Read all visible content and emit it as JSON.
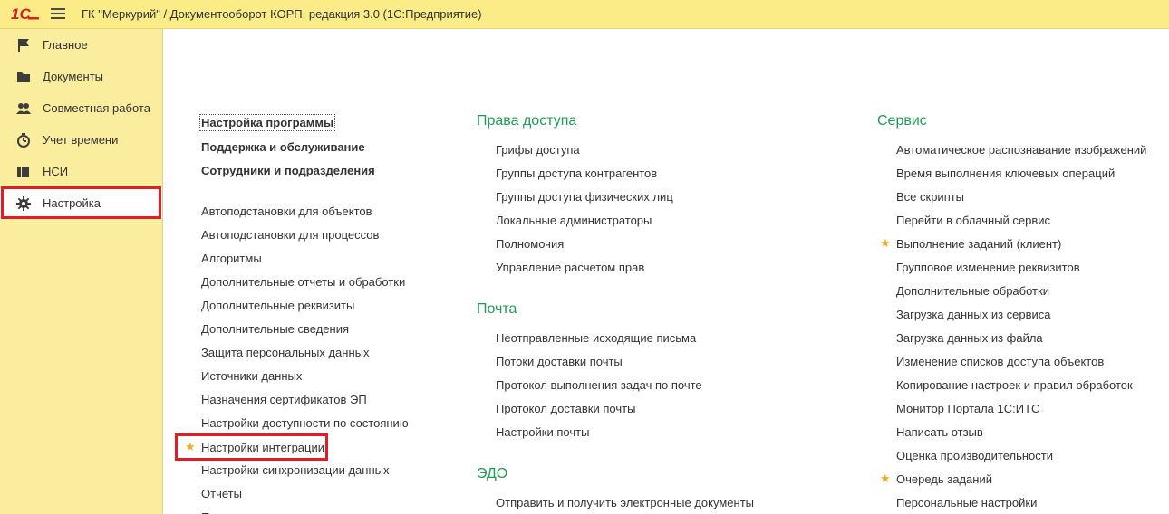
{
  "window": {
    "title": "ГК \"Меркурий\" / Документооборот КОРП, редакция 3.0  (1С:Предприятие)",
    "logo_text": "1С"
  },
  "sidebar": {
    "items": [
      {
        "label": "Главное",
        "icon": "flag-icon"
      },
      {
        "label": "Документы",
        "icon": "folder-icon"
      },
      {
        "label": "Совместная работа",
        "icon": "users-icon"
      },
      {
        "label": "Учет времени",
        "icon": "clock-icon"
      },
      {
        "label": "НСИ",
        "icon": "reference-book-icon"
      },
      {
        "label": "Настройка",
        "icon": "gear-icon",
        "active": true
      }
    ]
  },
  "col1": {
    "top_links": [
      "Настройка программы",
      "Поддержка и обслуживание",
      "Сотрудники и подразделения"
    ],
    "links": [
      "Автоподстановки для объектов",
      "Автоподстановки для процессов",
      "Алгоритмы",
      "Дополнительные отчеты и обработки",
      "Дополнительные реквизиты",
      "Дополнительные сведения",
      "Защита персональных данных",
      "Источники данных",
      "Назначения сертификатов ЭП",
      "Настройки доступности по состоянию",
      "Настройки интеграции",
      "Настройки синхронизации данных",
      "Отчеты"
    ]
  },
  "col2": {
    "sections": [
      {
        "title": "Права доступа",
        "links": [
          "Грифы доступа",
          "Группы доступа контрагентов",
          "Группы доступа физических лиц",
          "Локальные администраторы",
          "Полномочия",
          "Управление расчетом прав"
        ]
      },
      {
        "title": "Почта",
        "links": [
          "Неотправленные исходящие письма",
          "Потоки доставки почты",
          "Протокол выполнения задач по почте",
          "Протокол доставки почты",
          "Настройки почты"
        ]
      },
      {
        "title": "ЭДО",
        "links": [
          "Отправить и получить электронные документы"
        ]
      }
    ]
  },
  "col3": {
    "title": "Сервис",
    "links": [
      "Автоматическое распознавание изображений",
      "Время выполнения ключевых операций",
      "Все скрипты",
      "Перейти в облачный сервис",
      "Выполнение заданий (клиент)",
      "Групповое изменение реквизитов",
      "Дополнительные обработки",
      "Загрузка данных из сервиса",
      "Загрузка данных из файла",
      "Изменение списков доступа объектов",
      "Копирование настроек и правил обработок",
      "Монитор Портала 1С:ИТС",
      "Написать отзыв",
      "Оценка производительности",
      "Очередь заданий",
      "Персональные настройки"
    ]
  },
  "colors": {
    "titlebar_bg": "#fbec88",
    "sidebar_bg": "#fbed9e",
    "section_title": "#1f9b54",
    "highlight": "#e11d2a",
    "star": "#f0a92b",
    "logo_red": "#d6202a"
  }
}
